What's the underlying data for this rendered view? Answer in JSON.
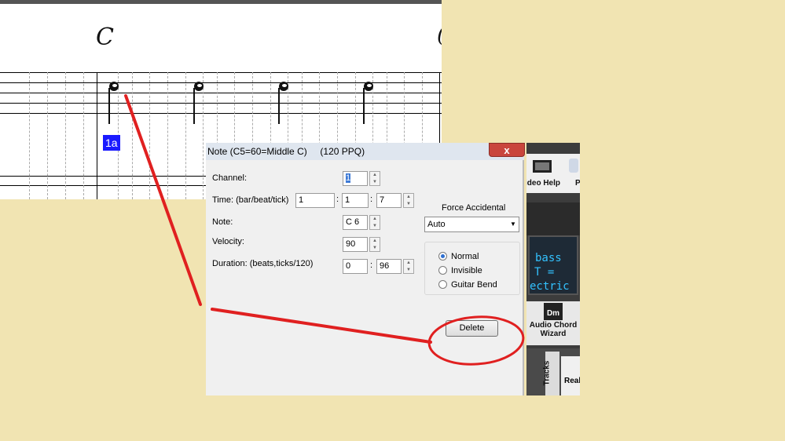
{
  "score": {
    "chord_symbol": "C",
    "lyric": "1a"
  },
  "background_app": {
    "video_help_label": "ideo Help",
    "p_label": "P",
    "lcd_lines": [
      "bass",
      "T =",
      "ectric"
    ],
    "audio_chord_wizard_icon": "Dm",
    "audio_chord_wizard_label": "Audio Chord Wizard",
    "tracks_tab": "Tracks",
    "real_label": "Real"
  },
  "dialog": {
    "title": "Note (C5=60=Middle C)     (120 PPQ)",
    "close_label": "x",
    "channel_label": "Channel:",
    "channel_value": "1",
    "time_label": "Time: (bar/beat/tick)",
    "time_bar": "1",
    "time_beat": "1",
    "time_tick": "7",
    "note_label": "Note:",
    "note_value": "C 6",
    "velocity_label": "Velocity:",
    "velocity_value": "90",
    "duration_label": "Duration: (beats,ticks/120)",
    "duration_beats": "0",
    "duration_ticks": "96",
    "colon": ":",
    "force_accidental_label": "Force Accidental",
    "force_accidental_value": "Auto",
    "radio_options": [
      "Normal",
      "Invisible",
      "Guitar Bend"
    ],
    "radio_selected": "Normal",
    "delete_label": "Delete"
  },
  "annotation": {
    "color": "#e02020"
  }
}
